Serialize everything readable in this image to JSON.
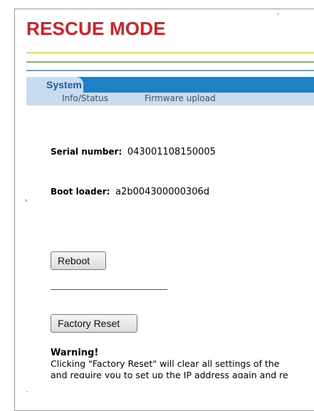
{
  "page": {
    "title": "RESCUE MODE"
  },
  "nav": {
    "tab_label": "System",
    "sub_items": [
      "Info/Status",
      "Firmware upload"
    ]
  },
  "fields": {
    "serial": {
      "label": "Serial number:",
      "value": "043001108150005"
    },
    "boot": {
      "label": "Boot loader:",
      "value": "a2b004300000306d"
    }
  },
  "buttons": {
    "reboot": "Reboot",
    "factory_reset": "Factory Reset"
  },
  "warning": {
    "title": "Warning!",
    "line1": "Clicking \"Factory Reset\" will clear all settings of the",
    "line2": "and require you to set up the IP address again and re"
  },
  "colors": {
    "title": "#d31f26",
    "nav_active": "#1f80c6",
    "nav_light": "#c9dcef",
    "line_yellow": "#e9df3f",
    "line_green": "#7fb86a",
    "line_blue": "#6ea6d6"
  }
}
